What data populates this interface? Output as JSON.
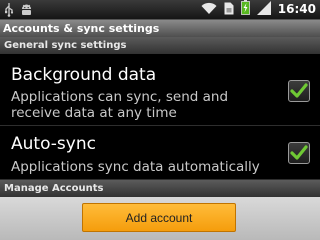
{
  "status_bar": {
    "time": "16:40",
    "icons": [
      "usb-icon",
      "android-debug-icon",
      "wifi-icon",
      "sim-card-icon",
      "battery-charging-icon",
      "signal-icon"
    ]
  },
  "title": "Accounts & sync settings",
  "sections": [
    {
      "header": "General sync settings",
      "items": [
        {
          "title": "Background data",
          "summary": "Applications can sync, send and receive data at any time",
          "checked": true
        },
        {
          "title": "Auto-sync",
          "summary": "Applications sync data automatically",
          "checked": true
        }
      ]
    },
    {
      "header": "Manage Accounts"
    }
  ],
  "add_account_label": "Add account",
  "colors": {
    "accent": "#f7a91b",
    "check": "#6fc934",
    "background": "#000000"
  }
}
